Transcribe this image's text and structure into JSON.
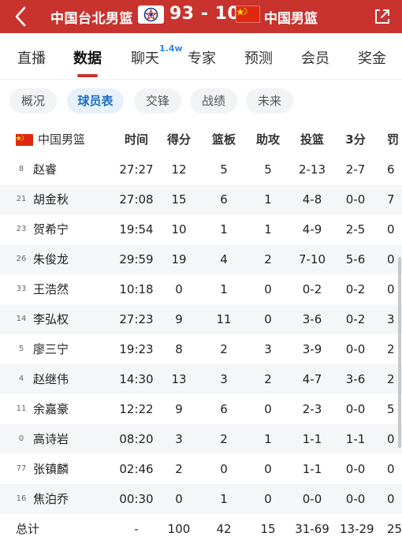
{
  "header": {
    "team1": "中国台北男篮",
    "score": "93 - 100",
    "team2": "中国男篮"
  },
  "tabs": [
    {
      "label": "直播"
    },
    {
      "label": "数据",
      "active": true
    },
    {
      "label": "聊天",
      "badge": "1.4w"
    },
    {
      "label": "专家"
    },
    {
      "label": "预测"
    },
    {
      "label": "会员"
    },
    {
      "label": "奖金"
    }
  ],
  "subtabs": [
    {
      "label": "概况"
    },
    {
      "label": "球员表",
      "active": true
    },
    {
      "label": "交锋"
    },
    {
      "label": "战绩"
    },
    {
      "label": "未来"
    }
  ],
  "table": {
    "team": "中国男篮",
    "columns": [
      "时间",
      "得分",
      "篮板",
      "助攻",
      "投篮",
      "3分",
      "罚"
    ],
    "players": [
      {
        "number": "8",
        "name": "赵睿",
        "time": "27:27",
        "pts": "12",
        "reb": "5",
        "ast": "5",
        "fg": "2-13",
        "tp": "2-7",
        "ft": "6"
      },
      {
        "number": "21",
        "name": "胡金秋",
        "time": "27:08",
        "pts": "15",
        "reb": "6",
        "ast": "1",
        "fg": "4-8",
        "tp": "0-0",
        "ft": "7"
      },
      {
        "number": "23",
        "name": "贺希宁",
        "time": "19:54",
        "pts": "10",
        "reb": "1",
        "ast": "1",
        "fg": "4-9",
        "tp": "2-5",
        "ft": "0"
      },
      {
        "number": "26",
        "name": "朱俊龙",
        "time": "29:59",
        "pts": "19",
        "reb": "4",
        "ast": "2",
        "fg": "7-10",
        "tp": "5-6",
        "ft": "0"
      },
      {
        "number": "33",
        "name": "王浩然",
        "time": "10:18",
        "pts": "0",
        "reb": "1",
        "ast": "0",
        "fg": "0-2",
        "tp": "0-2",
        "ft": "0"
      },
      {
        "number": "14",
        "name": "李弘权",
        "time": "27:23",
        "pts": "9",
        "reb": "11",
        "ast": "0",
        "fg": "3-6",
        "tp": "0-2",
        "ft": "3"
      },
      {
        "number": "5",
        "name": "廖三宁",
        "time": "19:23",
        "pts": "8",
        "reb": "2",
        "ast": "3",
        "fg": "3-9",
        "tp": "0-0",
        "ft": "2"
      },
      {
        "number": "4",
        "name": "赵继伟",
        "time": "14:30",
        "pts": "13",
        "reb": "3",
        "ast": "2",
        "fg": "4-7",
        "tp": "3-6",
        "ft": "2"
      },
      {
        "number": "11",
        "name": "余嘉豪",
        "time": "12:22",
        "pts": "9",
        "reb": "6",
        "ast": "0",
        "fg": "2-3",
        "tp": "0-0",
        "ft": "5"
      },
      {
        "number": "0",
        "name": "高诗岩",
        "time": "08:20",
        "pts": "3",
        "reb": "2",
        "ast": "1",
        "fg": "1-1",
        "tp": "1-1",
        "ft": "0"
      },
      {
        "number": "77",
        "name": "张镇麟",
        "time": "02:46",
        "pts": "2",
        "reb": "0",
        "ast": "0",
        "fg": "1-1",
        "tp": "0-0",
        "ft": "0"
      },
      {
        "number": "16",
        "name": "焦泊乔",
        "time": "00:30",
        "pts": "0",
        "reb": "1",
        "ast": "0",
        "fg": "0-0",
        "tp": "0-0",
        "ft": "0"
      }
    ],
    "total": {
      "label": "总计",
      "time": "-",
      "pts": "100",
      "reb": "42",
      "ast": "15",
      "fg": "31-69",
      "tp": "13-29",
      "ft": "25"
    }
  }
}
